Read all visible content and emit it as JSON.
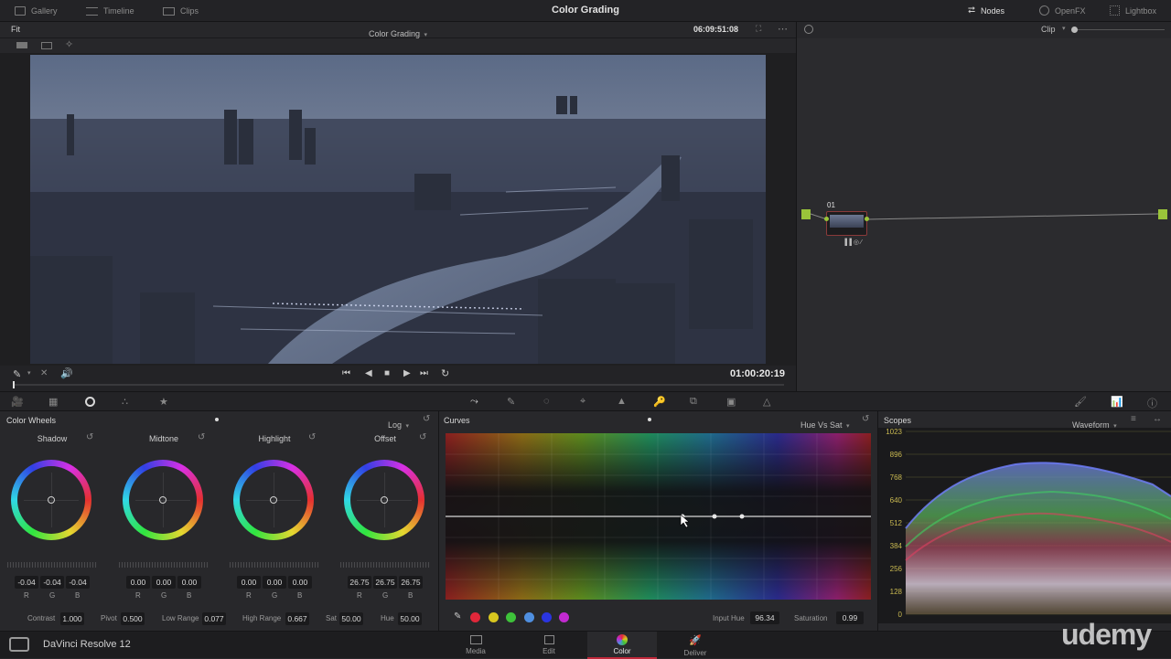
{
  "titlebar": {
    "title": "Color Grading",
    "left_tabs": [
      {
        "label": "Gallery",
        "icon": "gallery-icon"
      },
      {
        "label": "Timeline",
        "icon": "timeline-icon"
      },
      {
        "label": "Clips",
        "icon": "clips-icon"
      }
    ],
    "right_tabs": [
      {
        "label": "Nodes",
        "icon": "nodes-icon"
      },
      {
        "label": "OpenFX",
        "icon": "openfx-icon"
      },
      {
        "label": "Lightbox",
        "icon": "lightbox-icon"
      }
    ]
  },
  "viewer": {
    "fit_label": "Fit",
    "title": "Color Grading",
    "timecode_top": "06:09:51:08",
    "timecode_bottom": "01:00:20:19"
  },
  "nodes": {
    "mode": "Clip",
    "node_label": "01"
  },
  "tools_row": {
    "left_icons": [
      "camera-raw-icon",
      "color-match-icon",
      "color-wheels-icon",
      "rgb-mixer-icon",
      "motion-effects-icon"
    ],
    "center_icons": [
      "curves-icon",
      "qualifier-icon",
      "window-icon",
      "tracker-icon",
      "blur-icon",
      "key-icon",
      "sizing-icon",
      "3d-icon",
      "stereo-icon"
    ],
    "right_icons": [
      "paint-icon",
      "scopes-icon",
      "info-icon"
    ]
  },
  "color_wheels": {
    "title": "Color Wheels",
    "mode": "Log",
    "wheels": [
      {
        "name": "Shadow",
        "r": "-0.04",
        "g": "-0.04",
        "b": "-0.04"
      },
      {
        "name": "Midtone",
        "r": "0.00",
        "g": "0.00",
        "b": "0.00"
      },
      {
        "name": "Highlight",
        "r": "0.00",
        "g": "0.00",
        "b": "0.00"
      },
      {
        "name": "Offset",
        "r": "26.75",
        "g": "26.75",
        "b": "26.75"
      }
    ],
    "rgb_letters": [
      "R",
      "G",
      "B"
    ],
    "params": [
      {
        "label": "Contrast",
        "value": "1.000"
      },
      {
        "label": "Pivot",
        "value": "0.500"
      },
      {
        "label": "Low Range",
        "value": "0.077"
      },
      {
        "label": "High Range",
        "value": "0.667"
      },
      {
        "label": "Sat",
        "value": "50.00"
      },
      {
        "label": "Hue",
        "value": "50.00"
      }
    ]
  },
  "curves": {
    "title": "Curves",
    "mode": "Hue Vs Sat",
    "input_hue_label": "Input Hue",
    "input_hue": "96.34",
    "saturation_label": "Saturation",
    "saturation": "0.99",
    "swatches": [
      "#e0273a",
      "#d8c61f",
      "#3ec23a",
      "#4f8fe0",
      "#2a35e0",
      "#c22ad0"
    ]
  },
  "scopes": {
    "title": "Scopes",
    "mode": "Waveform",
    "ticks": [
      "1023",
      "896",
      "768",
      "640",
      "512",
      "384",
      "256",
      "128",
      "0"
    ]
  },
  "bottom_bar": {
    "app_name": "DaVinci Resolve 12",
    "pages": [
      {
        "label": "Media",
        "icon": "media-icon",
        "active": false
      },
      {
        "label": "Edit",
        "icon": "edit-icon",
        "active": false
      },
      {
        "label": "Color",
        "icon": "color-icon",
        "active": true
      },
      {
        "label": "Deliver",
        "icon": "deliver-icon",
        "active": false
      }
    ],
    "watermark": "udemy"
  }
}
